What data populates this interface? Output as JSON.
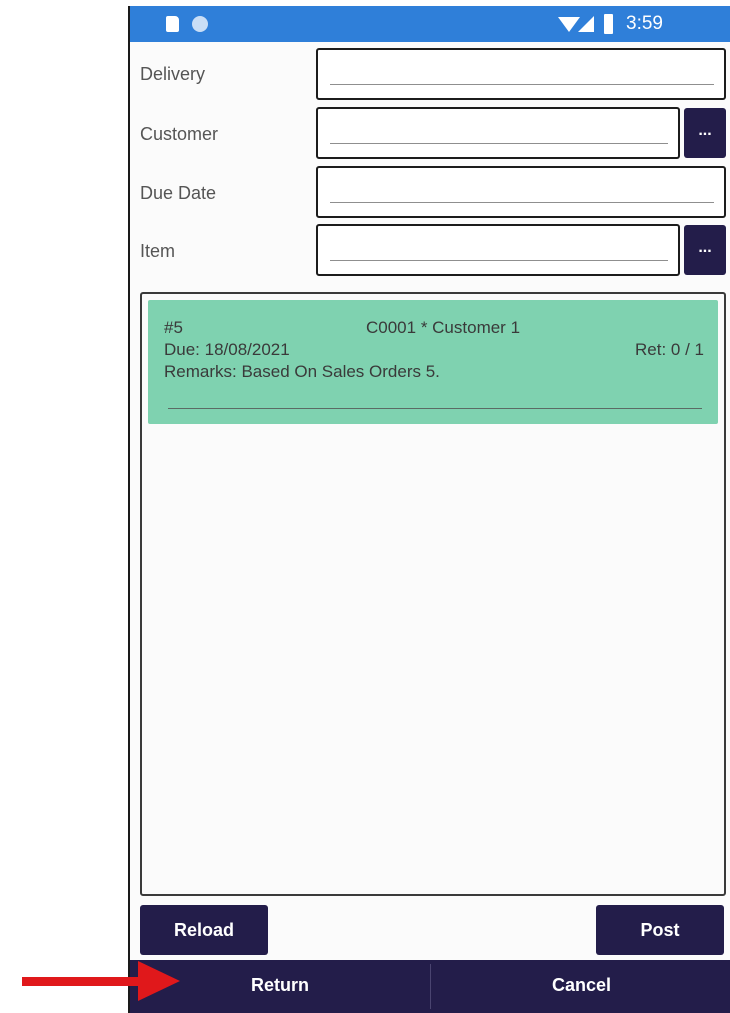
{
  "status_bar": {
    "time": "3:59",
    "icons": [
      "sd-card-icon",
      "circle-notification-icon",
      "wifi-icon",
      "signal-icon",
      "battery-icon"
    ]
  },
  "form": {
    "delivery_label": "Delivery",
    "delivery_value": "",
    "customer_label": "Customer",
    "customer_value": "",
    "due_date_label": "Due Date",
    "due_date_value": "",
    "item_label": "Item",
    "item_value": "",
    "more_label": "..."
  },
  "list": {
    "items": [
      {
        "number": "#5",
        "customer": "C0001 * Customer 1",
        "due": "Due: 18/08/2021",
        "ret": "Ret: 0 / 1",
        "remarks": "Remarks: Based On Sales Orders 5."
      }
    ]
  },
  "actions": {
    "reload": "Reload",
    "post": "Post"
  },
  "bottom_bar": {
    "return": "Return",
    "cancel": "Cancel"
  },
  "colors": {
    "status_bar": "#2f7fd9",
    "button": "#231d4a",
    "card": "#7fd2b0",
    "annotation_arrow": "#e0181b"
  }
}
